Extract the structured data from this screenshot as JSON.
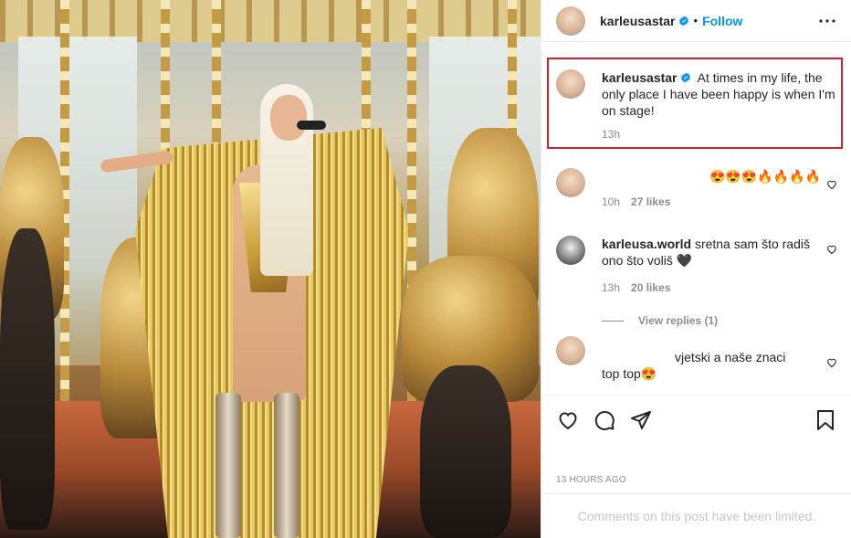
{
  "post": {
    "author": "karleusastar",
    "verified": true,
    "follow_label": "Follow",
    "separator": "•"
  },
  "caption": {
    "author": "karleusastar",
    "text": "At times in my life, the only place I have been happy is when I'm on stage!",
    "time": "13h",
    "highlight_color": "#d61f26"
  },
  "comments": [
    {
      "text": "😍😍😍🔥🔥🔥🔥",
      "time": "10h",
      "likes": "27 likes"
    },
    {
      "author": "karleusa.world",
      "text": "sretna sam što radiš ono što voliš 🖤",
      "time": "13h",
      "likes": "20 likes",
      "view_replies": "View replies (1)"
    },
    {
      "text_line1": "vjetski a naše znaci",
      "text_line2": "top top😍"
    }
  ],
  "footer": {
    "timestamp": "13 HOURS AGO",
    "limited_notice": "Comments on this post have been limited."
  },
  "icons": [
    "more-horizontal-icon",
    "verified-badge-icon",
    "heart-icon",
    "comment-icon",
    "share-icon",
    "bookmark-icon"
  ],
  "colors": {
    "accent": "#0095f6",
    "text": "#262626",
    "muted": "#8e8e8e"
  }
}
